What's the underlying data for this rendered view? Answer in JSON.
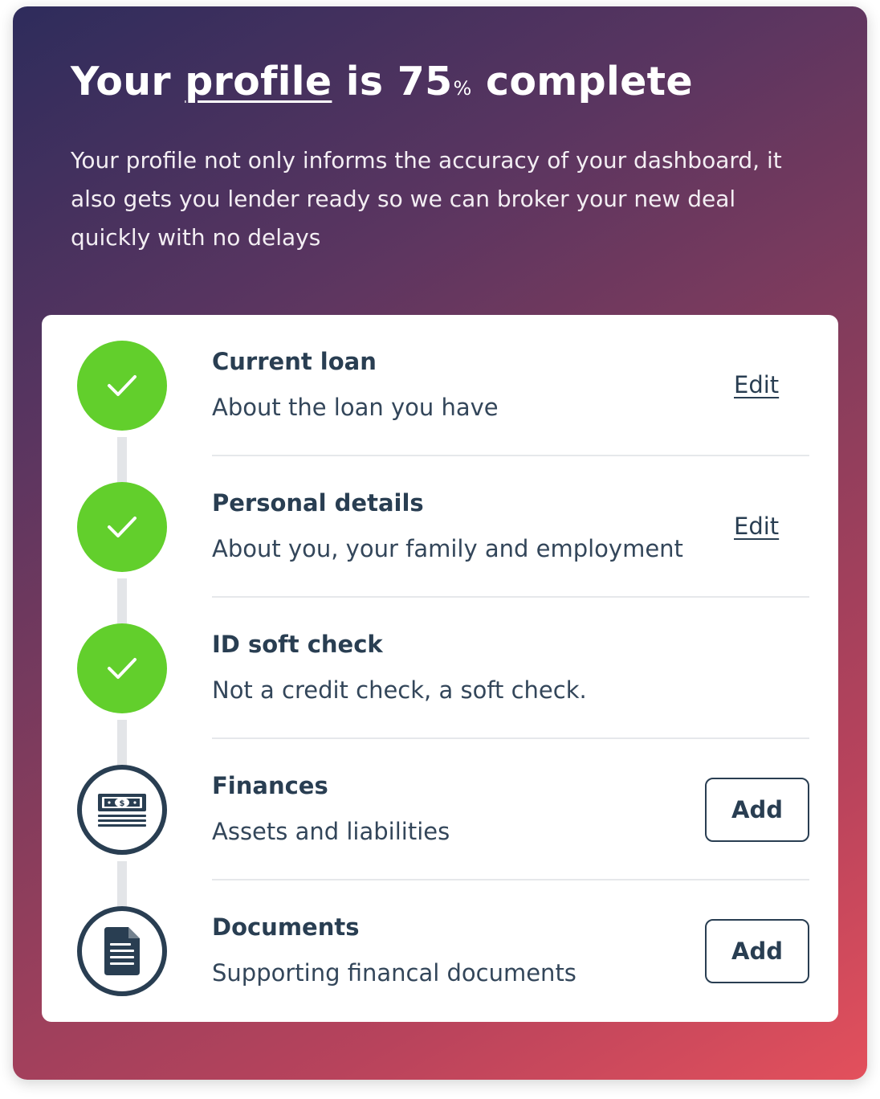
{
  "header": {
    "title_prefix": "Your",
    "title_link": "profile",
    "title_mid": "is 75",
    "title_pct": "%",
    "title_suffix": "complete",
    "progress_percent": 75,
    "intro": "Your profile not only informs the accuracy of your dashboard, it also gets you lender ready so we can broker your new deal quickly with no delays"
  },
  "steps": [
    {
      "title": "Current loan",
      "description": "About the loan you have",
      "status": "complete",
      "icon": "checkmark-icon",
      "action_label": "Edit"
    },
    {
      "title": "Personal details",
      "description": "About you, your family and employment",
      "status": "complete",
      "icon": "checkmark-icon",
      "action_label": "Edit"
    },
    {
      "title": "ID soft check",
      "description": "Not a credit check, a soft check.",
      "status": "complete",
      "icon": "checkmark-icon"
    },
    {
      "title": "Finances",
      "description": "Assets and liabilities",
      "status": "incomplete",
      "icon": "money-icon",
      "action_label": "Add"
    },
    {
      "title": "Documents",
      "description": "Supporting financal documents",
      "status": "incomplete",
      "icon": "document-icon",
      "action_label": "Add"
    }
  ],
  "colors": {
    "complete": "#62cf2c",
    "text_dark": "#293e52",
    "gradient_start": "#2e2c5c",
    "gradient_end": "#e3505c"
  }
}
